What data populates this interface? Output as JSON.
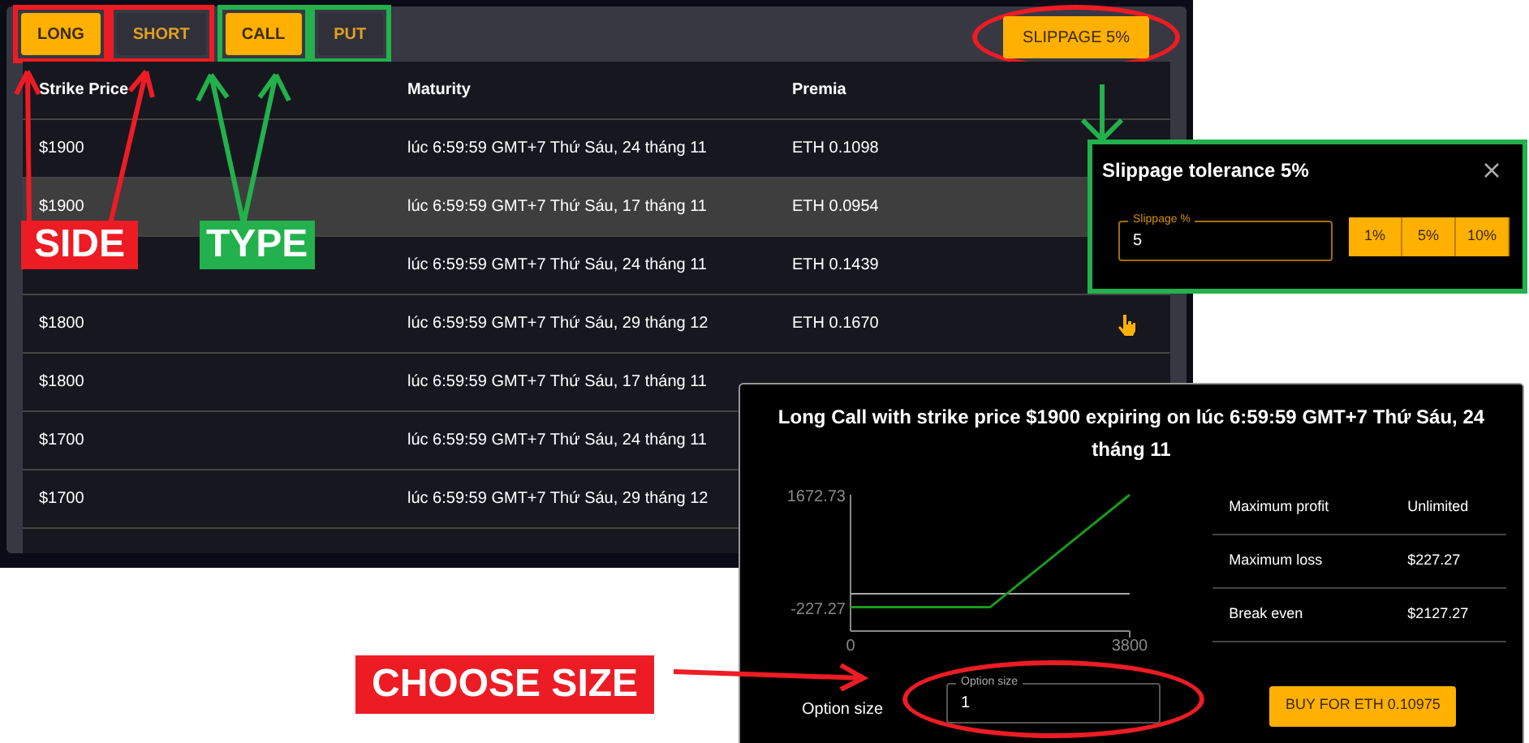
{
  "side_options": [
    {
      "label": "LONG",
      "selected": true
    },
    {
      "label": "SHORT",
      "selected": false
    }
  ],
  "type_options": [
    {
      "label": "CALL",
      "selected": true
    },
    {
      "label": "PUT",
      "selected": false
    }
  ],
  "slippage_button": "SLIPPAGE 5%",
  "table": {
    "columns": [
      "Strike Price",
      "Maturity",
      "Premia"
    ],
    "rows": [
      {
        "strike": "$1900",
        "maturity": "lúc 6:59:59 GMT+7 Thứ Sáu, 24 tháng 11",
        "premia": "ETH 0.1098",
        "selected": false,
        "action": false
      },
      {
        "strike": "$1900",
        "maturity": "lúc 6:59:59 GMT+7 Thứ Sáu, 17 tháng 11",
        "premia": "ETH 0.0954",
        "selected": true,
        "action": false
      },
      {
        "maturity": "lúc 6:59:59 GMT+7 Thứ Sáu, 24 tháng 11",
        "premia": "ETH 0.1439",
        "selected": false,
        "action": false
      },
      {
        "strike": "$1800",
        "maturity": "lúc 6:59:59 GMT+7 Thứ Sáu, 29 tháng 12",
        "premia": "ETH 0.1670",
        "selected": false,
        "action": true
      },
      {
        "strike": "$1800",
        "maturity": "lúc 6:59:59 GMT+7 Thứ Sáu, 17 tháng 11",
        "selected": false,
        "action": false
      },
      {
        "strike": "$1700",
        "maturity": "lúc 6:59:59 GMT+7 Thứ Sáu, 24 tháng 11",
        "selected": false,
        "action": false
      },
      {
        "strike": "$1700",
        "maturity": "lúc 6:59:59 GMT+7 Thứ Sáu, 29 tháng 12",
        "selected": false,
        "action": false
      }
    ]
  },
  "slippage_dialog": {
    "title": "Slippage tolerance 5%",
    "field": {
      "label": "Slippage %",
      "value": "5"
    },
    "presets": [
      "1%",
      "5%",
      "10%"
    ]
  },
  "order_dialog": {
    "title": "Long Call with strike price $1900 expiring on lúc 6:59:59 GMT+7 Thứ Sáu, 24 tháng 11",
    "chart_data": {
      "type": "line",
      "x": [
        0,
        1900,
        3800
      ],
      "series": [
        {
          "color": "#1a9a1a",
          "values": [
            -227.27,
            -227.27,
            1672.73
          ]
        }
      ],
      "xlim": [
        0,
        3800
      ],
      "ylim": [
        -630,
        1672.73
      ],
      "xticks": [
        0,
        3800
      ],
      "yticks": [
        -227.27,
        1672.73
      ]
    },
    "stats": [
      {
        "label": "Maximum profit",
        "value": "Unlimited"
      },
      {
        "label": "Maximum loss",
        "value": "$227.27"
      },
      {
        "label": "Break even",
        "value": "$2127.27"
      }
    ],
    "size_label": "Option size",
    "size_field": {
      "label": "Option size",
      "value": "1"
    },
    "buy_button": "BUY FOR ETH 0.10975"
  },
  "annotations": [
    {
      "text": "SIDE",
      "color": "#ed1c24"
    },
    {
      "text": "TYPE",
      "color": "#22b14c"
    },
    {
      "text": "CHOOSE SIZE",
      "color": "#ed1c24"
    }
  ]
}
